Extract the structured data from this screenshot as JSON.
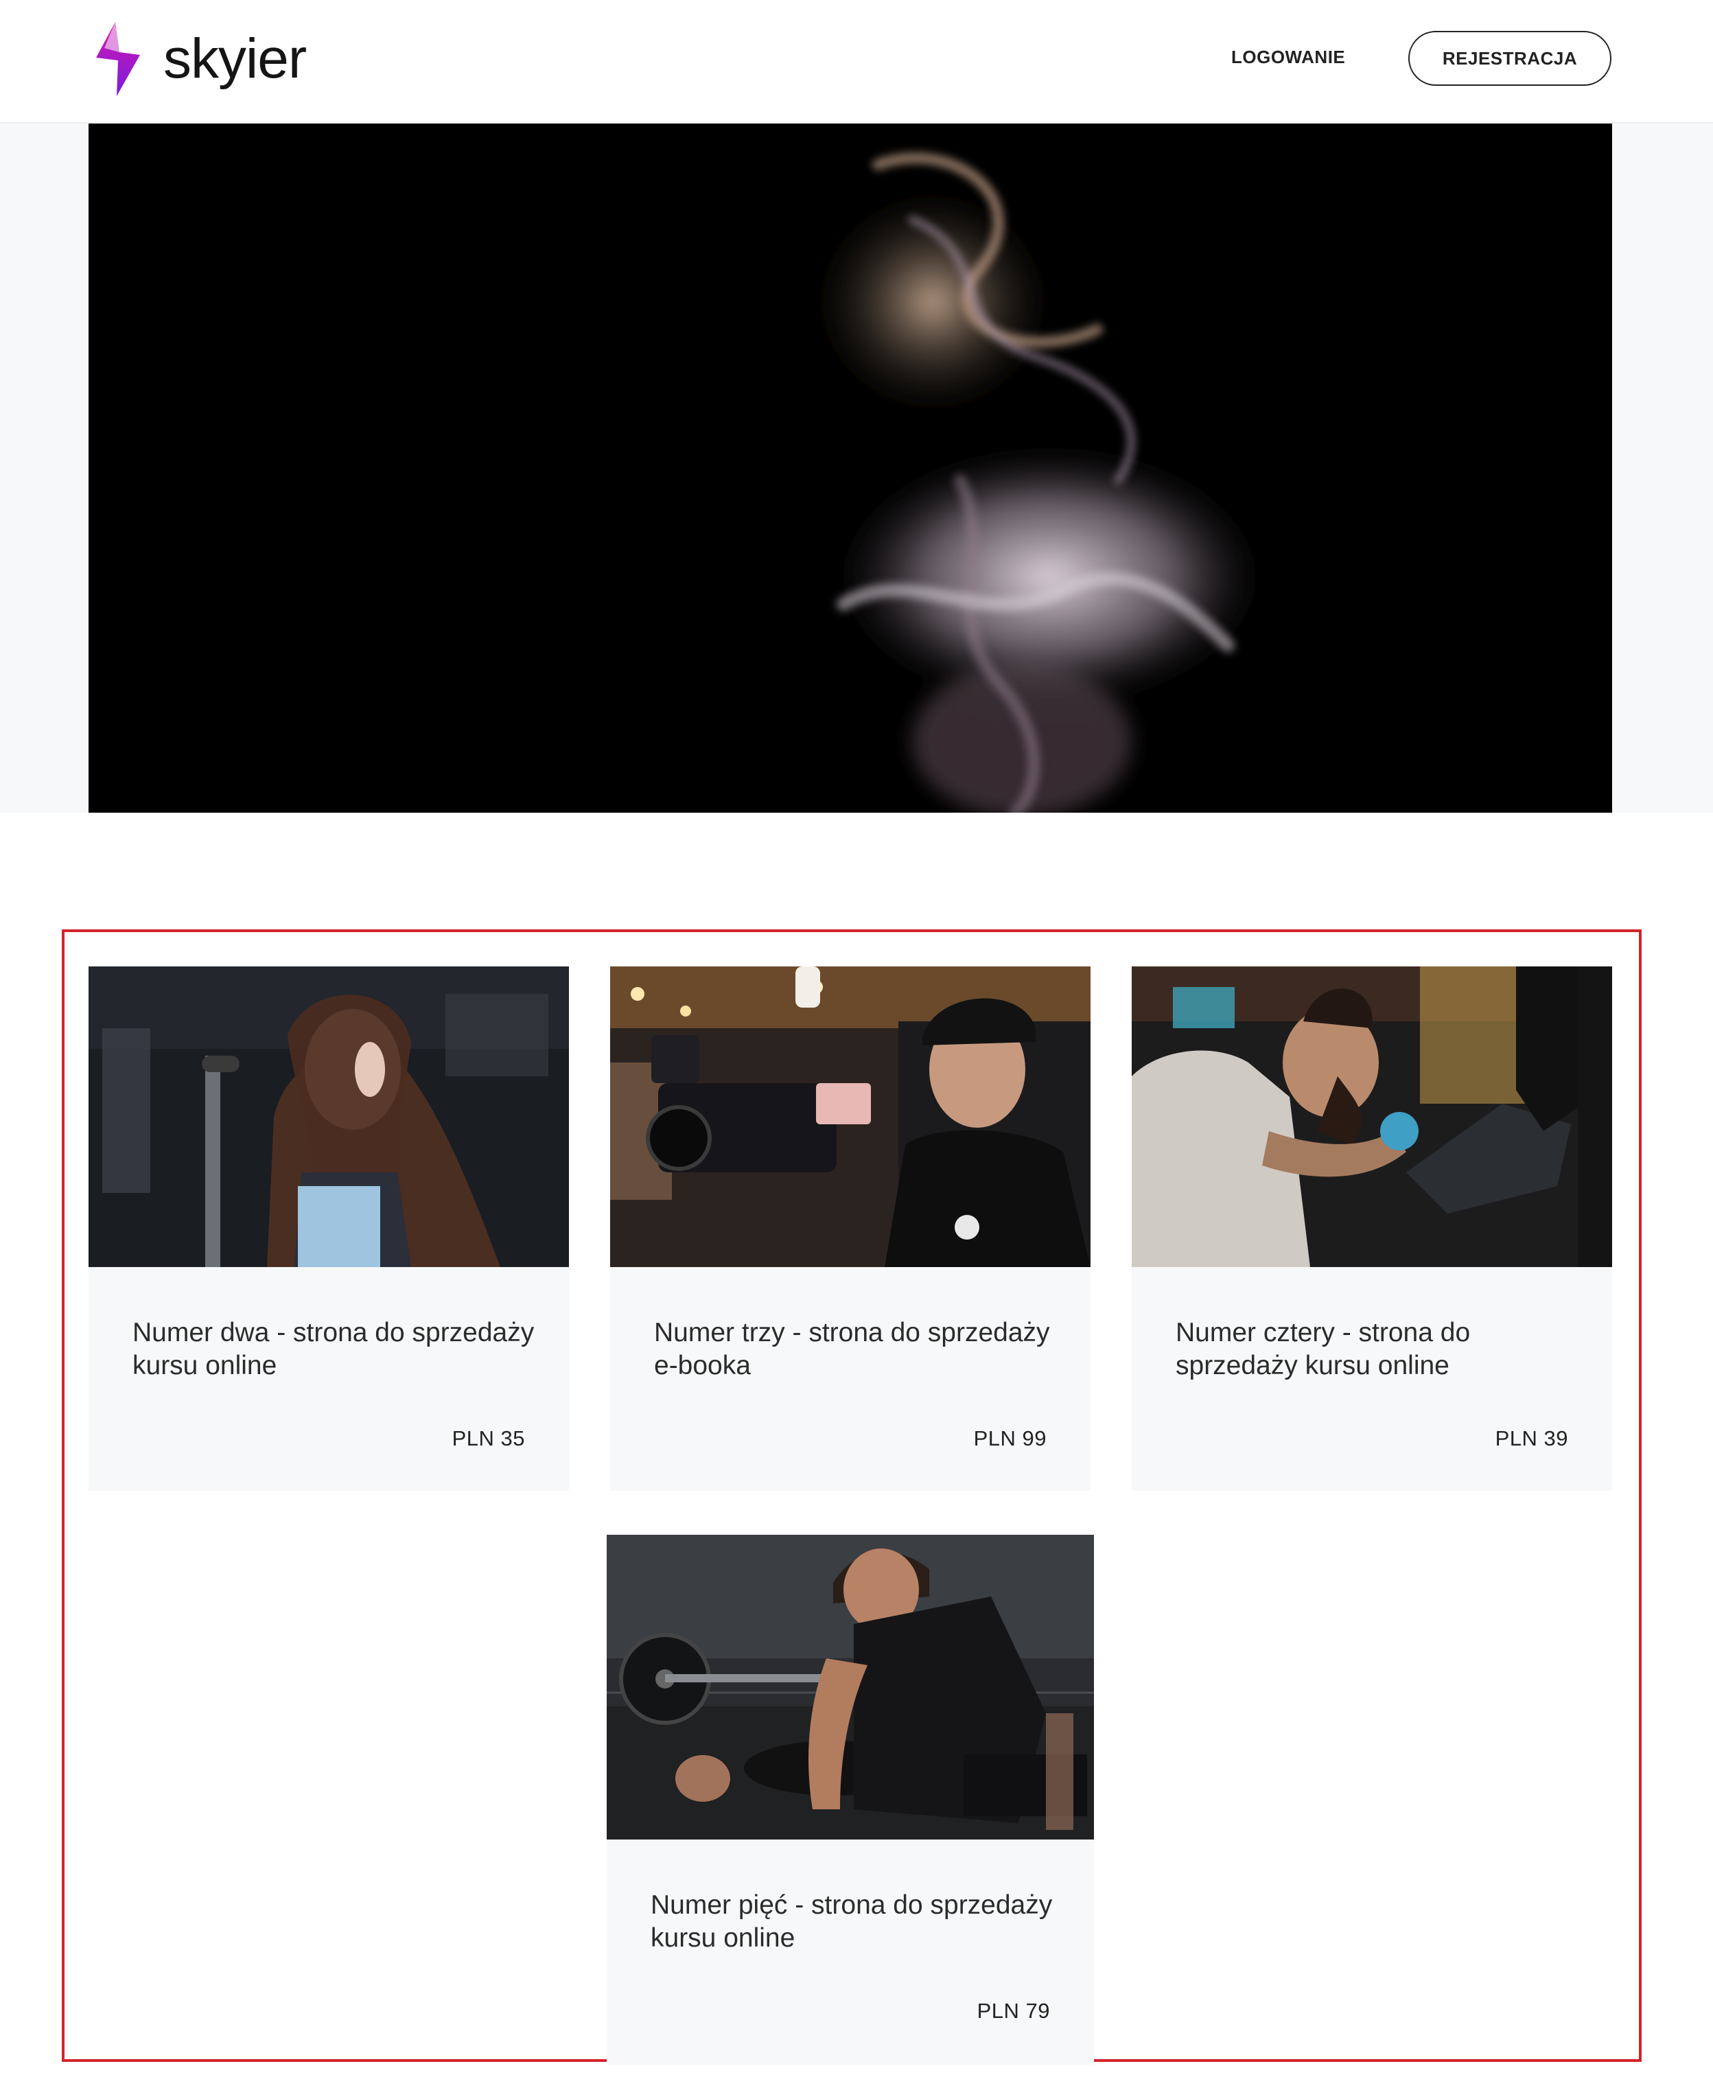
{
  "header": {
    "logo_text": "skyier",
    "nav": {
      "login_label": "LOGOWANIE",
      "register_label": "REJESTRACJA"
    }
  },
  "products": [
    {
      "title": "Numer dwa - strona do sprzedaży kursu online",
      "price": "PLN 35"
    },
    {
      "title": "Numer trzy - strona do sprzedaży e-booka",
      "price": "PLN 99"
    },
    {
      "title": "Numer cztery - strona do sprzedaży kursu online",
      "price": "PLN 39"
    },
    {
      "title": "Numer pięć - strona do sprzedaży kursu online",
      "price": "PLN 79"
    }
  ],
  "colors": {
    "accent_purple": "#a020f0",
    "highlight_border": "#d4232a",
    "card_background": "#f7f8f9"
  }
}
